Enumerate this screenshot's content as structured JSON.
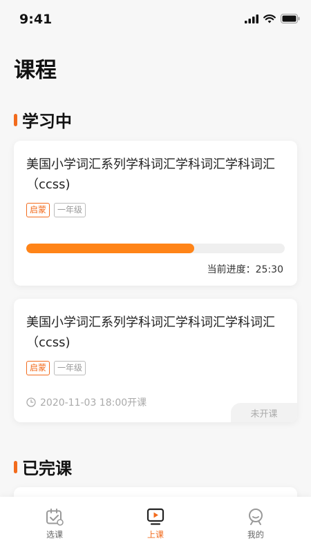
{
  "status_bar": {
    "time": "9:41",
    "icons": [
      "signal-icon",
      "wifi-icon",
      "battery-icon"
    ]
  },
  "page_title": "课程",
  "sections": [
    {
      "title": "学习中"
    },
    {
      "title": "已完课"
    }
  ],
  "courses": [
    {
      "title": "美国小学词汇系列学科词汇学科词汇学科词汇（ccss)",
      "tags": [
        "启蒙",
        "一年级"
      ],
      "progress_fraction": 0.65,
      "progress_text": "当前进度：25:30"
    },
    {
      "title": "美国小学词汇系列学科词汇学科词汇学科词汇（ccss)",
      "tags": [
        "启蒙",
        "一年级"
      ],
      "schedule_text": "2020-11-03 18:00开课",
      "status": "未开课"
    }
  ],
  "tabbar": {
    "items": [
      {
        "label": "选课",
        "icon": "course-select-icon",
        "active": false
      },
      {
        "label": "上课",
        "icon": "class-play-icon",
        "active": true
      },
      {
        "label": "我的",
        "icon": "profile-icon",
        "active": false
      }
    ]
  },
  "colors": {
    "accent": "#f26b1d",
    "progress": "#ff8418",
    "muted": "#aaaaaa"
  }
}
